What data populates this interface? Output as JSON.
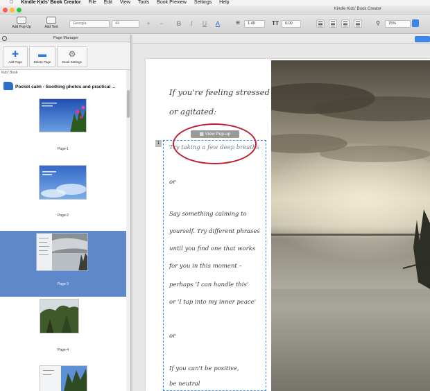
{
  "menubar": {
    "apple": "",
    "app": "Kindle Kids' Book Creator",
    "items": [
      "File",
      "Edit",
      "View",
      "Tools",
      "Book Preview",
      "Settings",
      "Help"
    ]
  },
  "window": {
    "title": "Kindle Kids' Book Creator"
  },
  "toolbar": {
    "add_popup": "Add Pop-Up",
    "add_text": "Add Text",
    "font": "Georgia",
    "font_size": "44",
    "plus": "+",
    "minus": "−",
    "bold": "B",
    "italic": "I",
    "underline": "U",
    "color": "A",
    "line_spacing": "1.49",
    "char_spacing": "0.00",
    "zoom": "75%"
  },
  "panel": {
    "title": "Page Manager",
    "add_page": "Add Page",
    "delete_page": "Delete Page",
    "book_settings": "Book Settings",
    "kids_book_label": "Kids' Book",
    "book_title": "Pocket calm - Soothing photos and practical ...",
    "pages": [
      "Page-1",
      "Page-2",
      "Page-3",
      "Page-4"
    ]
  },
  "page": {
    "heading_line1": "If you're feeling stressed",
    "heading_line2": "or agitated:",
    "view_popup": "View Pop-up",
    "popup_number": "1",
    "lines": [
      "Try taking a few deep breaths",
      "or",
      "Say something calming to",
      "yourself. Try different phrases",
      "until you find one that works",
      "for you in this moment –",
      "perhaps 'I can handle this'",
      "or 'I tap into my inner peace'",
      "or",
      "If you can't be positive,",
      "be neutral"
    ]
  },
  "colors": {
    "selection": "#5e88c9",
    "popup_border": "#3a8be2",
    "annotation": "#c11d2c",
    "accent": "#3b86e6"
  }
}
